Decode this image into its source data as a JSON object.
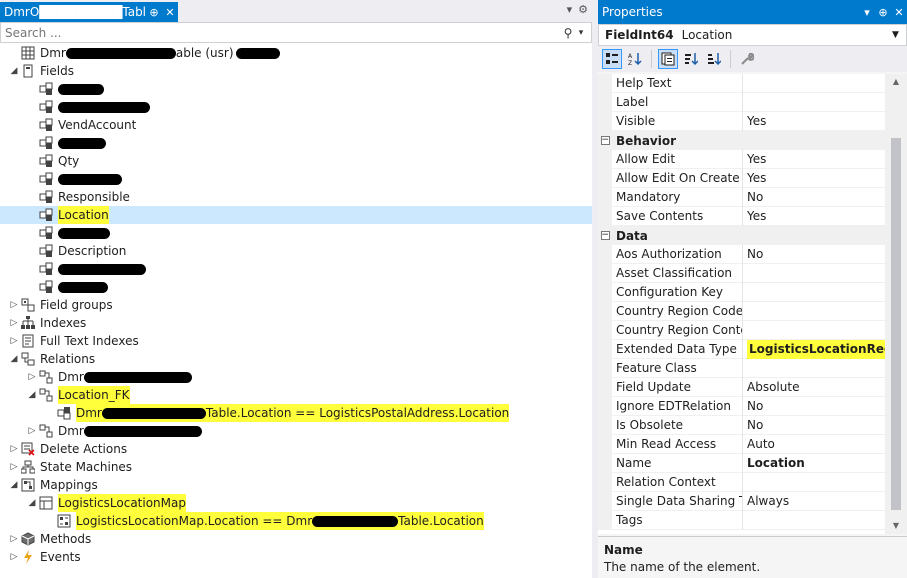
{
  "doc_tab": {
    "title": "DmrO█████████Table",
    "pin_glyph": "⊕",
    "close_glyph": "✕"
  },
  "tabbar_right": {
    "dropdown_glyph": "▾",
    "settings_glyph": "⚙"
  },
  "search": {
    "placeholder": "Search ...",
    "icon_glyph": "⚲",
    "drop_glyph": "▾"
  },
  "tree": [
    {
      "depth": 0,
      "expander": "",
      "icon": "table-icon",
      "label": "Dmr",
      "mask1": 110,
      "after": "able (usr)",
      "mask2": 44,
      "selected": false,
      "highlight": false
    },
    {
      "depth": 0,
      "expander": "expanded",
      "icon": "fields-folder-icon",
      "label": "Fields",
      "selected": false,
      "highlight": false
    },
    {
      "depth": 1,
      "expander": "",
      "icon": "field-icon",
      "label": "",
      "mask1": 46,
      "selected": false,
      "highlight": false
    },
    {
      "depth": 1,
      "expander": "",
      "icon": "field-icon",
      "label": "",
      "mask1": 92,
      "selected": false,
      "highlight": false
    },
    {
      "depth": 1,
      "expander": "",
      "icon": "field-icon",
      "label": "VendAccount",
      "selected": false,
      "highlight": false
    },
    {
      "depth": 1,
      "expander": "",
      "icon": "field-icon",
      "label": "",
      "mask1": 48,
      "selected": false,
      "highlight": false
    },
    {
      "depth": 1,
      "expander": "",
      "icon": "field-icon",
      "label": "Qty",
      "selected": false,
      "highlight": false
    },
    {
      "depth": 1,
      "expander": "",
      "icon": "field-icon",
      "label": "",
      "mask1": 64,
      "selected": false,
      "highlight": false
    },
    {
      "depth": 1,
      "expander": "",
      "icon": "field-icon",
      "label": "Responsible",
      "selected": false,
      "highlight": false
    },
    {
      "depth": 1,
      "expander": "",
      "icon": "field-icon",
      "label": "Location",
      "selected": true,
      "highlight": true
    },
    {
      "depth": 1,
      "expander": "",
      "icon": "field-icon",
      "label": "",
      "mask1": 52,
      "selected": false,
      "highlight": false
    },
    {
      "depth": 1,
      "expander": "",
      "icon": "field-icon",
      "label": "Description",
      "selected": false,
      "highlight": false
    },
    {
      "depth": 1,
      "expander": "",
      "icon": "field-icon",
      "label": "",
      "mask1": 88,
      "selected": false,
      "highlight": false
    },
    {
      "depth": 1,
      "expander": "",
      "icon": "field-icon",
      "label": "",
      "mask1": 50,
      "selected": false,
      "highlight": false
    },
    {
      "depth": 0,
      "expander": "collapsed",
      "icon": "field-groups-icon",
      "label": "Field groups",
      "selected": false,
      "highlight": false
    },
    {
      "depth": 0,
      "expander": "collapsed",
      "icon": "indexes-icon",
      "label": "Indexes",
      "selected": false,
      "highlight": false
    },
    {
      "depth": 0,
      "expander": "collapsed",
      "icon": "full-text-indexes-icon",
      "label": "Full Text Indexes",
      "selected": false,
      "highlight": false
    },
    {
      "depth": 0,
      "expander": "expanded",
      "icon": "relations-icon",
      "label": "Relations",
      "selected": false,
      "highlight": false
    },
    {
      "depth": 1,
      "expander": "collapsed",
      "icon": "relation-icon",
      "label": "Dmr",
      "mask1": 108,
      "selected": false,
      "highlight": false
    },
    {
      "depth": 1,
      "expander": "expanded",
      "icon": "relation-icon",
      "label": "Location_FK",
      "selected": false,
      "highlight": true
    },
    {
      "depth": 2,
      "expander": "",
      "icon": "relation-constraint-icon",
      "label": "Dmr",
      "mask1": 104,
      "after": "Table.Location == LogisticsPostalAddress.Location",
      "selected": false,
      "highlight": true
    },
    {
      "depth": 1,
      "expander": "collapsed",
      "icon": "relation-icon",
      "label": "Dmr",
      "mask1": 118,
      "selected": false,
      "highlight": false
    },
    {
      "depth": 0,
      "expander": "collapsed",
      "icon": "delete-actions-icon",
      "label": "Delete Actions",
      "selected": false,
      "highlight": false
    },
    {
      "depth": 0,
      "expander": "collapsed",
      "icon": "state-machines-icon",
      "label": "State Machines",
      "selected": false,
      "highlight": false
    },
    {
      "depth": 0,
      "expander": "expanded",
      "icon": "mappings-icon",
      "label": "Mappings",
      "selected": false,
      "highlight": false
    },
    {
      "depth": 1,
      "expander": "expanded",
      "icon": "mapping-icon",
      "label": "LogisticsLocationMap",
      "selected": false,
      "highlight": true
    },
    {
      "depth": 2,
      "expander": "",
      "icon": "mapping-field-icon",
      "label": "LogisticsLocationMap.Location == Dmr",
      "mask1": 86,
      "after": "Table.Location",
      "selected": false,
      "highlight": true
    },
    {
      "depth": 0,
      "expander": "collapsed",
      "icon": "methods-icon",
      "label": "Methods",
      "selected": false,
      "highlight": false
    },
    {
      "depth": 0,
      "expander": "collapsed",
      "icon": "events-icon",
      "label": "Events",
      "selected": false,
      "highlight": false
    }
  ],
  "properties": {
    "title": "Properties",
    "title_buttons": [
      "▾",
      "⊕",
      "✕"
    ],
    "object_type": "FieldInt64",
    "object_name": "Location",
    "rows": [
      {
        "kind": "prop",
        "name": "Help Text",
        "value": ""
      },
      {
        "kind": "prop",
        "name": "Label",
        "value": ""
      },
      {
        "kind": "prop",
        "name": "Visible",
        "value": "Yes"
      },
      {
        "kind": "cat",
        "name": "Behavior"
      },
      {
        "kind": "prop",
        "name": "Allow Edit",
        "value": "Yes"
      },
      {
        "kind": "prop",
        "name": "Allow Edit On Create",
        "value": "Yes"
      },
      {
        "kind": "prop",
        "name": "Mandatory",
        "value": "No"
      },
      {
        "kind": "prop",
        "name": "Save Contents",
        "value": "Yes"
      },
      {
        "kind": "cat",
        "name": "Data"
      },
      {
        "kind": "prop",
        "name": "Aos Authorization",
        "value": "No"
      },
      {
        "kind": "prop",
        "name": "Asset Classification",
        "value": ""
      },
      {
        "kind": "prop",
        "name": "Configuration Key",
        "value": ""
      },
      {
        "kind": "prop",
        "name": "Country Region Codes",
        "value": ""
      },
      {
        "kind": "prop",
        "name": "Country Region Context",
        "value": ""
      },
      {
        "kind": "prop",
        "name": "Extended Data Type",
        "value": "LogisticsLocationRecId",
        "highlight": true
      },
      {
        "kind": "prop",
        "name": "Feature Class",
        "value": ""
      },
      {
        "kind": "prop",
        "name": "Field Update",
        "value": "Absolute"
      },
      {
        "kind": "prop",
        "name": "Ignore EDTRelation",
        "value": "No"
      },
      {
        "kind": "prop",
        "name": "Is Obsolete",
        "value": "No"
      },
      {
        "kind": "prop",
        "name": "Min Read Access",
        "value": "Auto"
      },
      {
        "kind": "prop",
        "name": "Name",
        "value": "Location",
        "bold": true
      },
      {
        "kind": "prop",
        "name": "Relation Context",
        "value": ""
      },
      {
        "kind": "prop",
        "name": "Single Data Sharing Type",
        "value": "Always"
      },
      {
        "kind": "prop",
        "name": "Tags",
        "value": ""
      }
    ],
    "description": {
      "name": "Name",
      "text": "The name of the element."
    }
  },
  "colors": {
    "accent": "#007acc",
    "selection": "#cce8ff",
    "highlight": "#ffff3c"
  }
}
